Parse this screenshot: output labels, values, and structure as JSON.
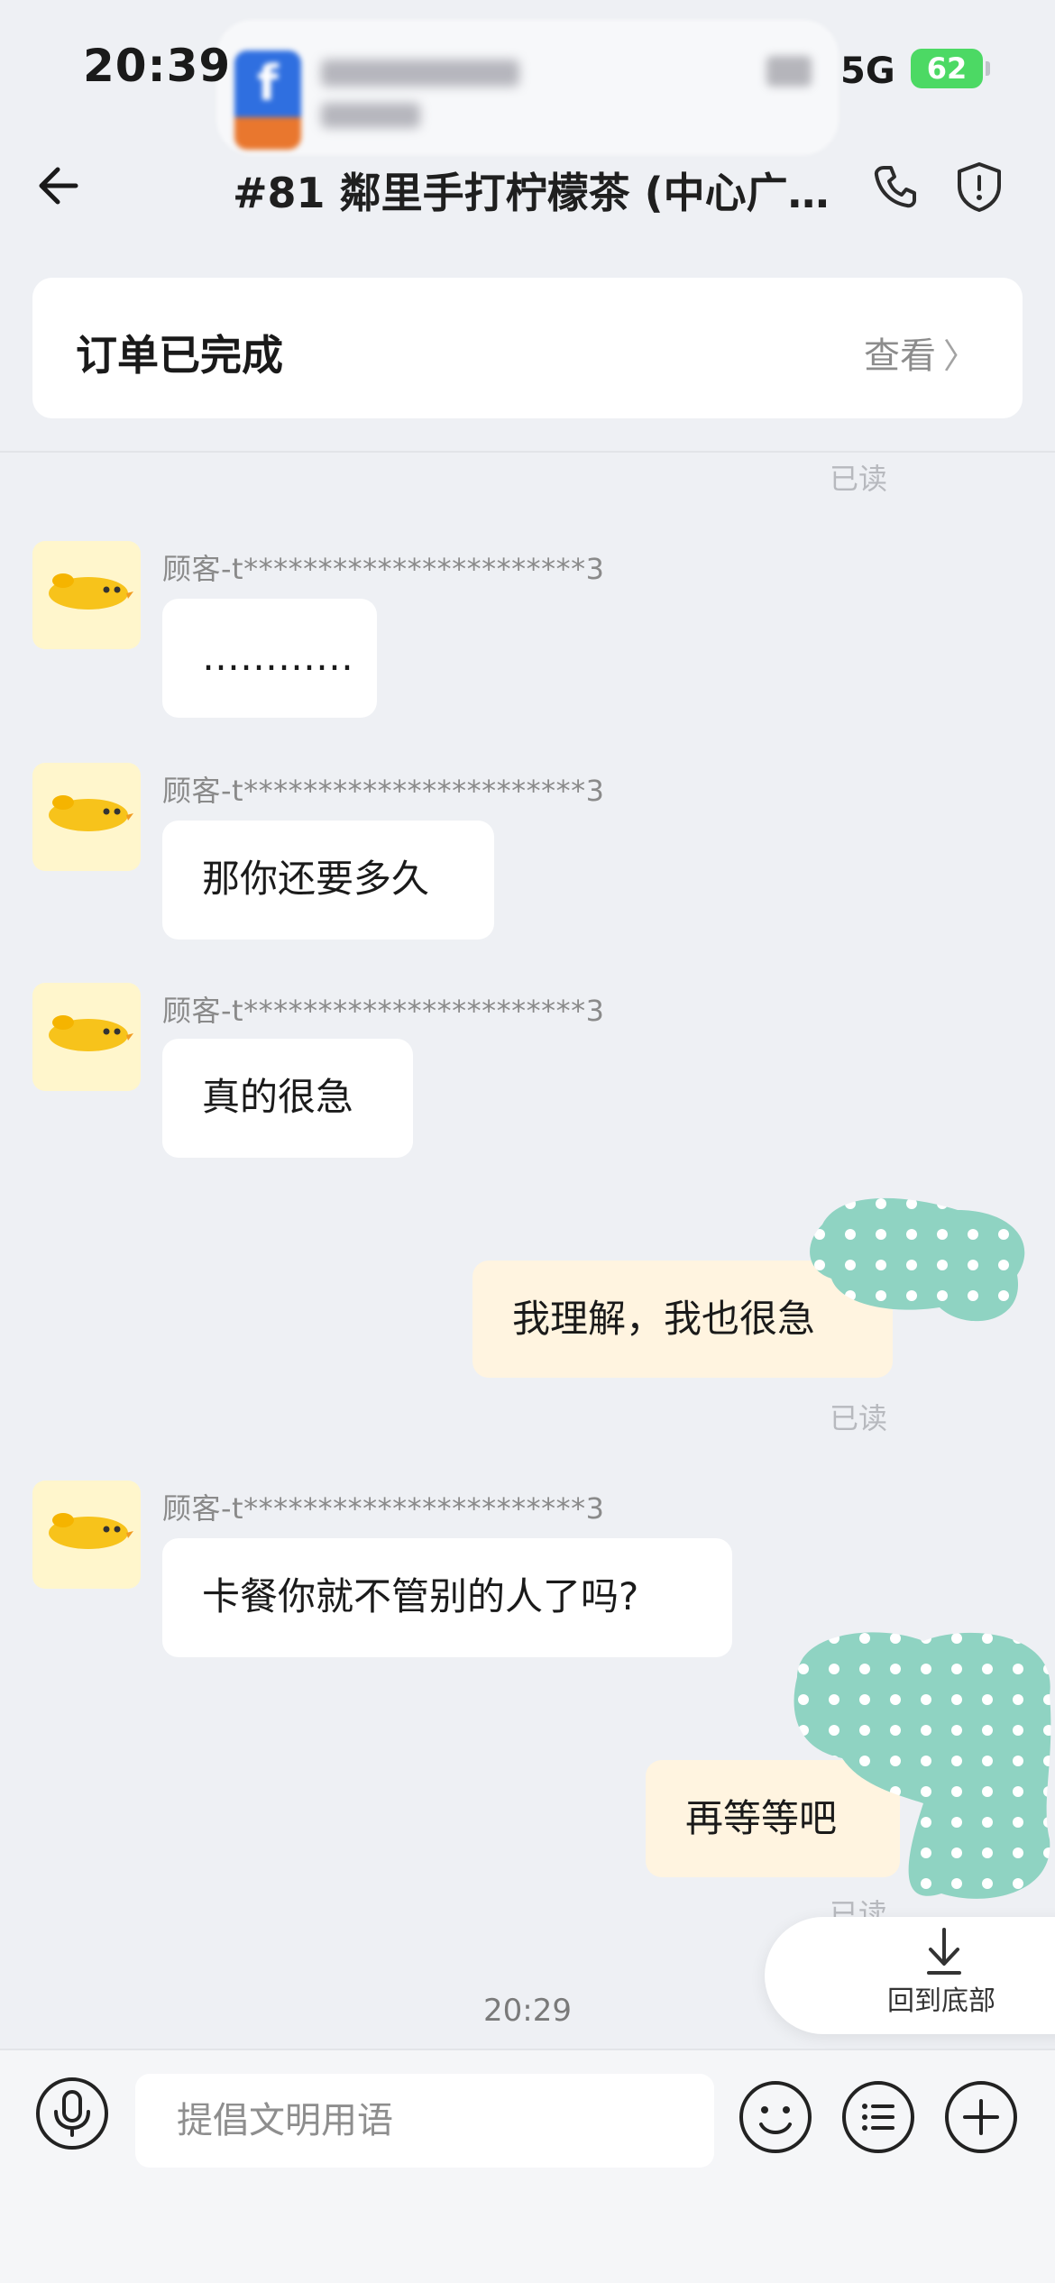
{
  "status_bar": {
    "time": "20:39",
    "network": "5G",
    "battery": "62"
  },
  "nav": {
    "title": "#81 鄰里手打柠檬茶 (中心广…"
  },
  "order": {
    "status": "订单已完成",
    "view_label": "查看",
    "view_chevron": "〉"
  },
  "read_label": "已读",
  "messages": [
    {
      "sender": "顾客-t***********************3",
      "text": "…………"
    },
    {
      "sender": "顾客-t***********************3",
      "text": "那你还要多久"
    },
    {
      "sender": "顾客-t***********************3",
      "text": "真的很急"
    },
    {
      "sender": "",
      "text": "我理解，我也很急",
      "mine": true
    },
    {
      "sender": "顾客-t***********************3",
      "text": "卡餐你就不管别的人了吗?"
    },
    {
      "sender": "",
      "text": "再等等吧",
      "mine": true
    }
  ],
  "jump_to_bottom": "回到底部",
  "timestamp": "20:29",
  "input": {
    "placeholder": "提倡文明用语"
  },
  "colors": {
    "background": "#eef0f4",
    "own_bubble": "#fff4e0",
    "battery": "#4cd964",
    "sticker": "#8fd3c2"
  }
}
